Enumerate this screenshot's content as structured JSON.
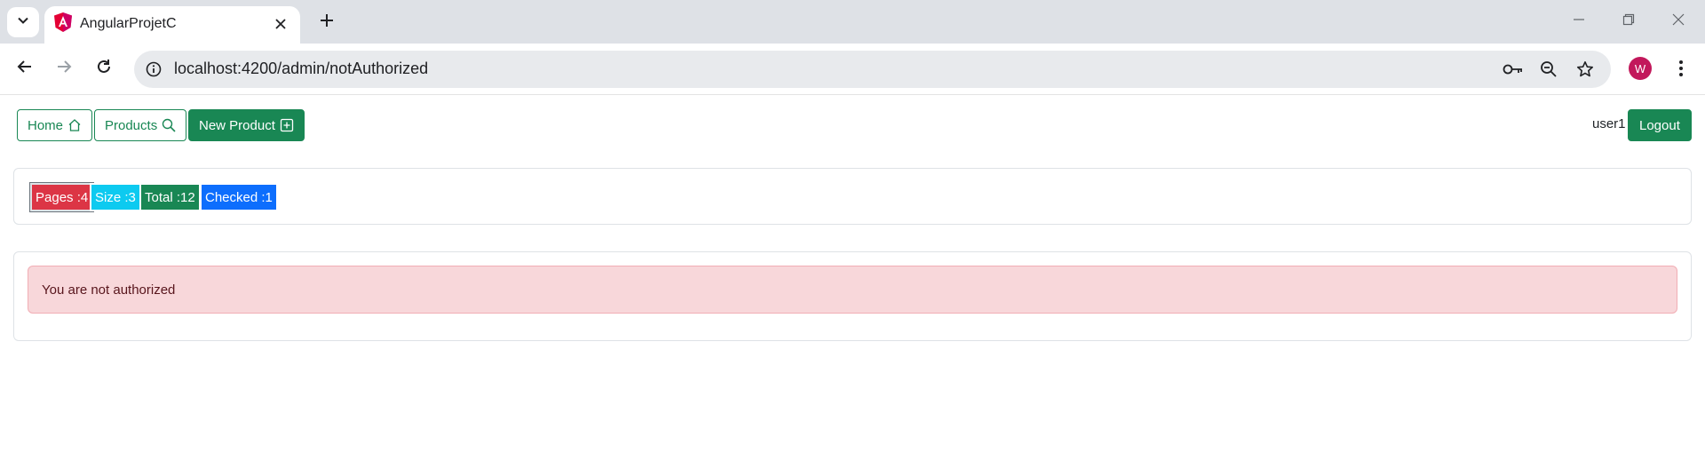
{
  "browser": {
    "tab_title": "AngularProjetC",
    "url": "localhost:4200/admin/notAuthorized",
    "profile_initial": "W"
  },
  "nav": {
    "home_label": "Home",
    "products_label": "Products",
    "new_product_label": "New Product"
  },
  "user": {
    "username": "user1",
    "logout_label": "Logout"
  },
  "stats": {
    "pages": "Pages :4",
    "size": "Size :3",
    "total": "Total :12",
    "checked": "Checked :1"
  },
  "alert": {
    "message": "You are not authorized"
  },
  "colors": {
    "success": "#198754",
    "danger": "#dc3545",
    "info": "#0dcaf0",
    "primary": "#0d6efd",
    "alert_bg": "#f8d7da"
  }
}
